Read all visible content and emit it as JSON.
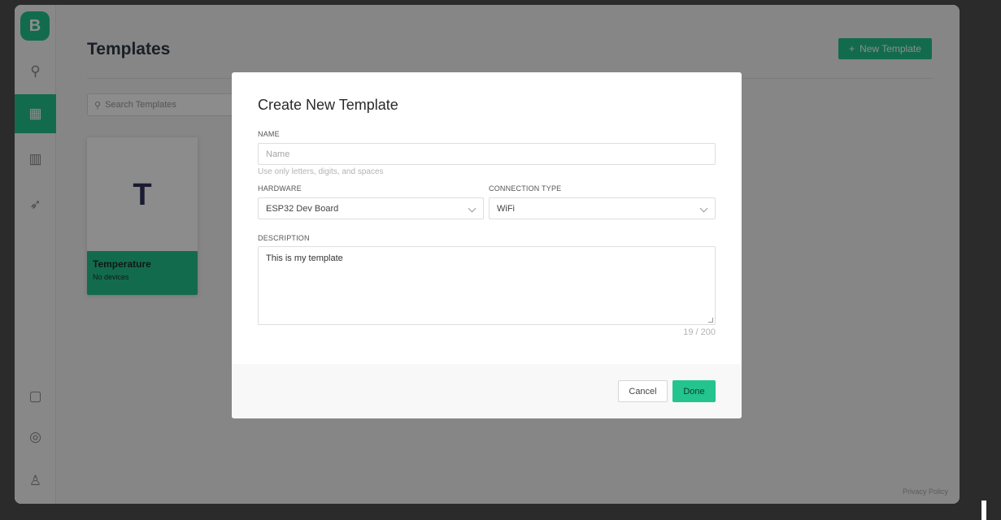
{
  "app": {
    "logo_letter": "B",
    "accent_color": "#23c48e"
  },
  "sidebar": {
    "items": [
      {
        "icon": "search-icon",
        "glyph": "⚲"
      },
      {
        "icon": "templates-grid-icon",
        "glyph": "▦",
        "active": true
      },
      {
        "icon": "building-icon",
        "glyph": "▥"
      },
      {
        "icon": "rocket-icon",
        "glyph": "➶"
      },
      {
        "icon": "device-icon",
        "glyph": "▢"
      },
      {
        "icon": "settings-icon",
        "glyph": "◎"
      },
      {
        "icon": "user-icon",
        "glyph": "♙"
      }
    ]
  },
  "header": {
    "title": "Templates",
    "new_button_label": "New Template"
  },
  "search": {
    "placeholder": "Search Templates"
  },
  "templates": [
    {
      "letter": "T",
      "name": "Temperature",
      "status": "No devices"
    }
  ],
  "footer": {
    "privacy_label": "Privacy Policy"
  },
  "modal": {
    "title": "Create New Template",
    "name_label": "NAME",
    "name_placeholder": "Name",
    "name_hint": "Use only letters, digits, and spaces",
    "hardware_label": "HARDWARE",
    "hardware_value": "ESP32 Dev Board",
    "connection_label": "CONNECTION TYPE",
    "connection_value": "WiFi",
    "description_label": "DESCRIPTION",
    "description_value": "This is my template",
    "char_counter": "19 / 200",
    "cancel_label": "Cancel",
    "done_label": "Done"
  }
}
